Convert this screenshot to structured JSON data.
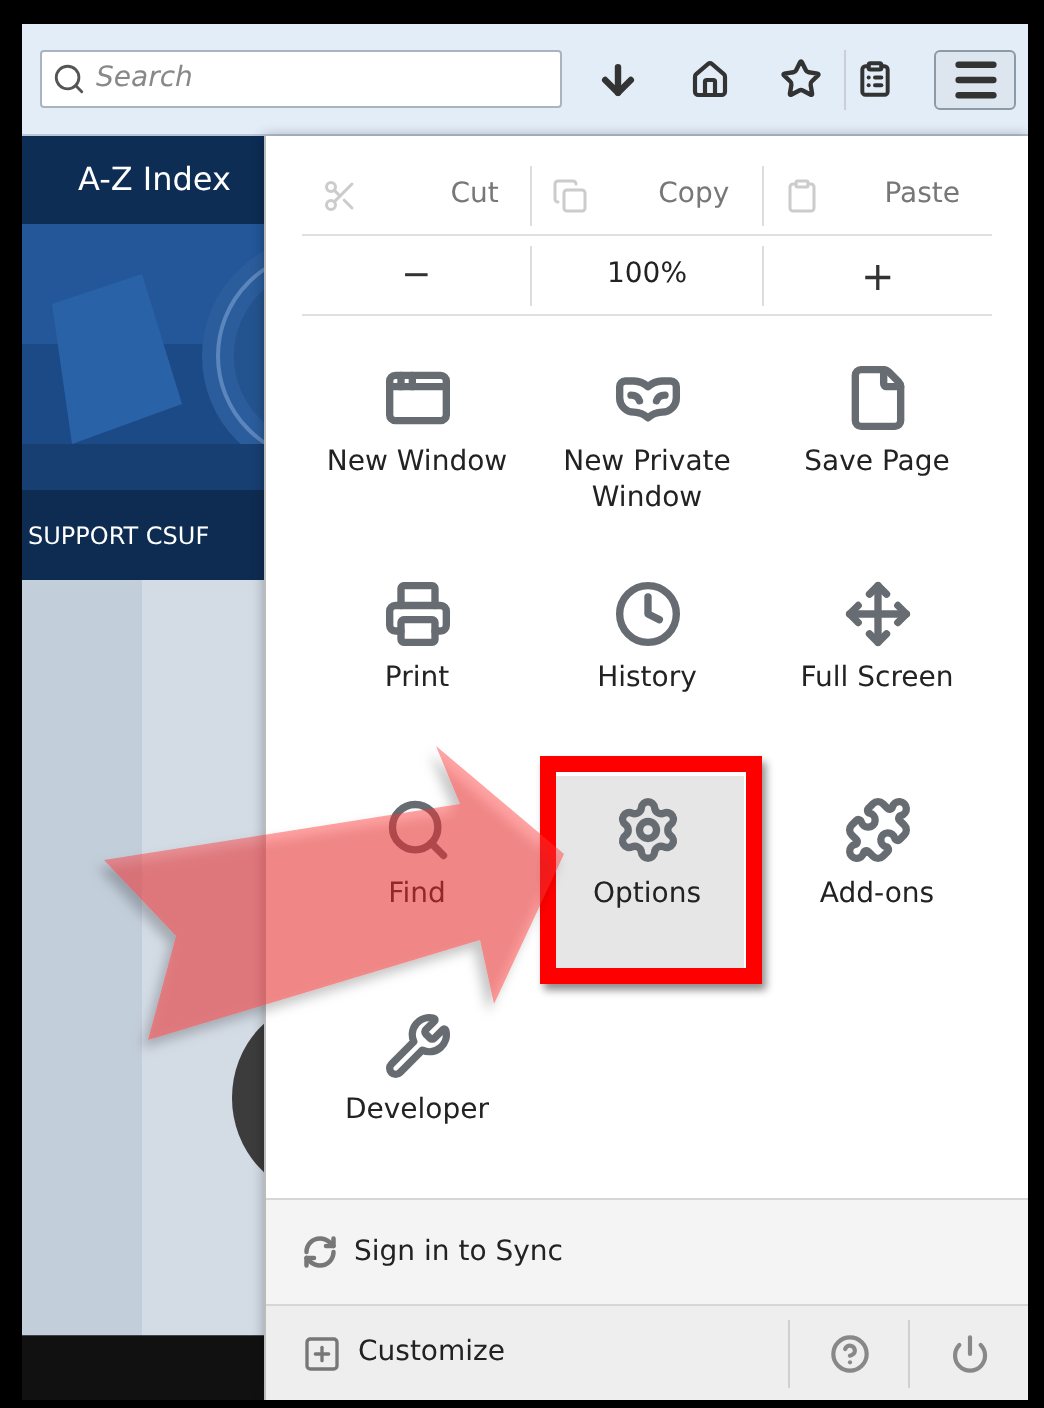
{
  "toolbar": {
    "search": {
      "placeholder": "Search"
    }
  },
  "page": {
    "nav_link": "A-Z Index",
    "banner": "SUPPORT CSUF"
  },
  "menu": {
    "edit_row": [
      {
        "label": "Cut",
        "disabled": true
      },
      {
        "label": "Copy",
        "disabled": true
      },
      {
        "label": "Paste",
        "disabled": true
      }
    ],
    "zoom_row": {
      "minus": "−",
      "level_text": "100%",
      "plus": "+"
    },
    "items": [
      {
        "label": "New Window",
        "selected": false,
        "disabled": false
      },
      {
        "label": "New Private Window",
        "selected": false,
        "disabled": false
      },
      {
        "label": "Save Page",
        "selected": false,
        "disabled": false
      },
      {
        "label": "Print",
        "selected": false,
        "disabled": false
      },
      {
        "label": "History",
        "selected": false,
        "disabled": false
      },
      {
        "label": "Full Screen",
        "selected": false,
        "disabled": false
      },
      {
        "label": "Find",
        "selected": false,
        "disabled": false
      },
      {
        "label": "Options",
        "selected": true,
        "disabled": false
      },
      {
        "label": "Add-ons",
        "selected": false,
        "disabled": false
      },
      {
        "label": "Developer",
        "selected": false,
        "disabled": false
      }
    ],
    "sync": "Sign in to Sync",
    "customize": "Customize"
  }
}
